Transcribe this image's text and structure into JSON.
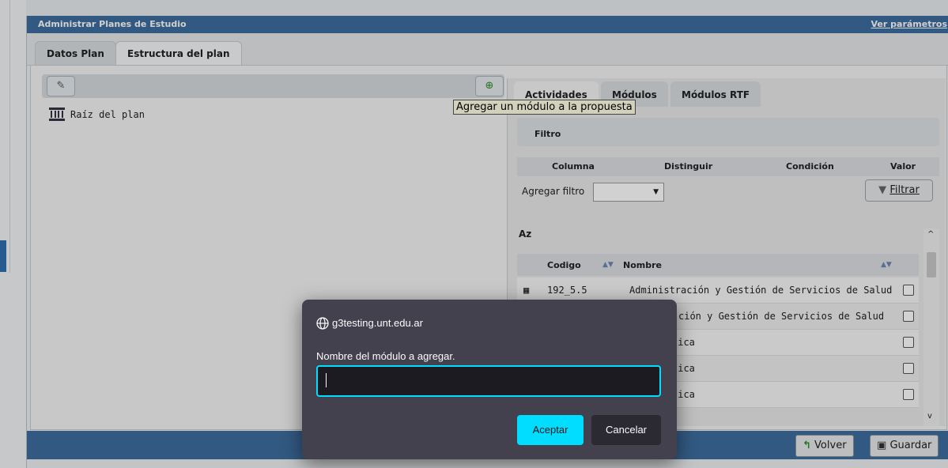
{
  "window": {
    "title": "Administrar Planes de Estudio",
    "link": "Ver parámetros"
  },
  "tabs": [
    {
      "label": "Datos Plan"
    },
    {
      "label": "Estructura del plan"
    }
  ],
  "tree": {
    "root_label": "Raíz del plan"
  },
  "tooltip": "Agregar un módulo a la propuesta",
  "right_tabs": [
    {
      "label": "Actividades"
    },
    {
      "label": "Módulos"
    },
    {
      "label": "Módulos RTF"
    }
  ],
  "filter": {
    "title": "Filtro",
    "columns": {
      "columna": "Columna",
      "distinguir": "Distinguir",
      "condicion": "Condición",
      "valor": "Valor"
    },
    "add_label": "Agregar filtro",
    "button": "Filtrar"
  },
  "grid": {
    "sort_icon": "Az",
    "headers": {
      "codigo": "Codigo",
      "nombre": "Nombre"
    },
    "rows": [
      {
        "codigo": "192_5.5",
        "nombre": "Administración y Gestión de Servicios de Salud"
      },
      {
        "codigo": "",
        "nombre": "ción y Gestión de Servicios de Salud"
      },
      {
        "codigo": "",
        "nombre": "tica"
      },
      {
        "codigo": "",
        "nombre": "tica"
      },
      {
        "codigo": "",
        "nombre": "tica"
      }
    ]
  },
  "footer": {
    "volver": "Volver",
    "guardar": "Guardar"
  },
  "dialog": {
    "host": "g3testing.unt.edu.ar",
    "message": "Nombre del módulo a agregar.",
    "input_value": "",
    "accept": "Aceptar",
    "cancel": "Cancelar"
  },
  "colors": {
    "titlebar": "#3d6d9e",
    "dialog_bg": "#42414d",
    "accent": "#00ddff"
  }
}
